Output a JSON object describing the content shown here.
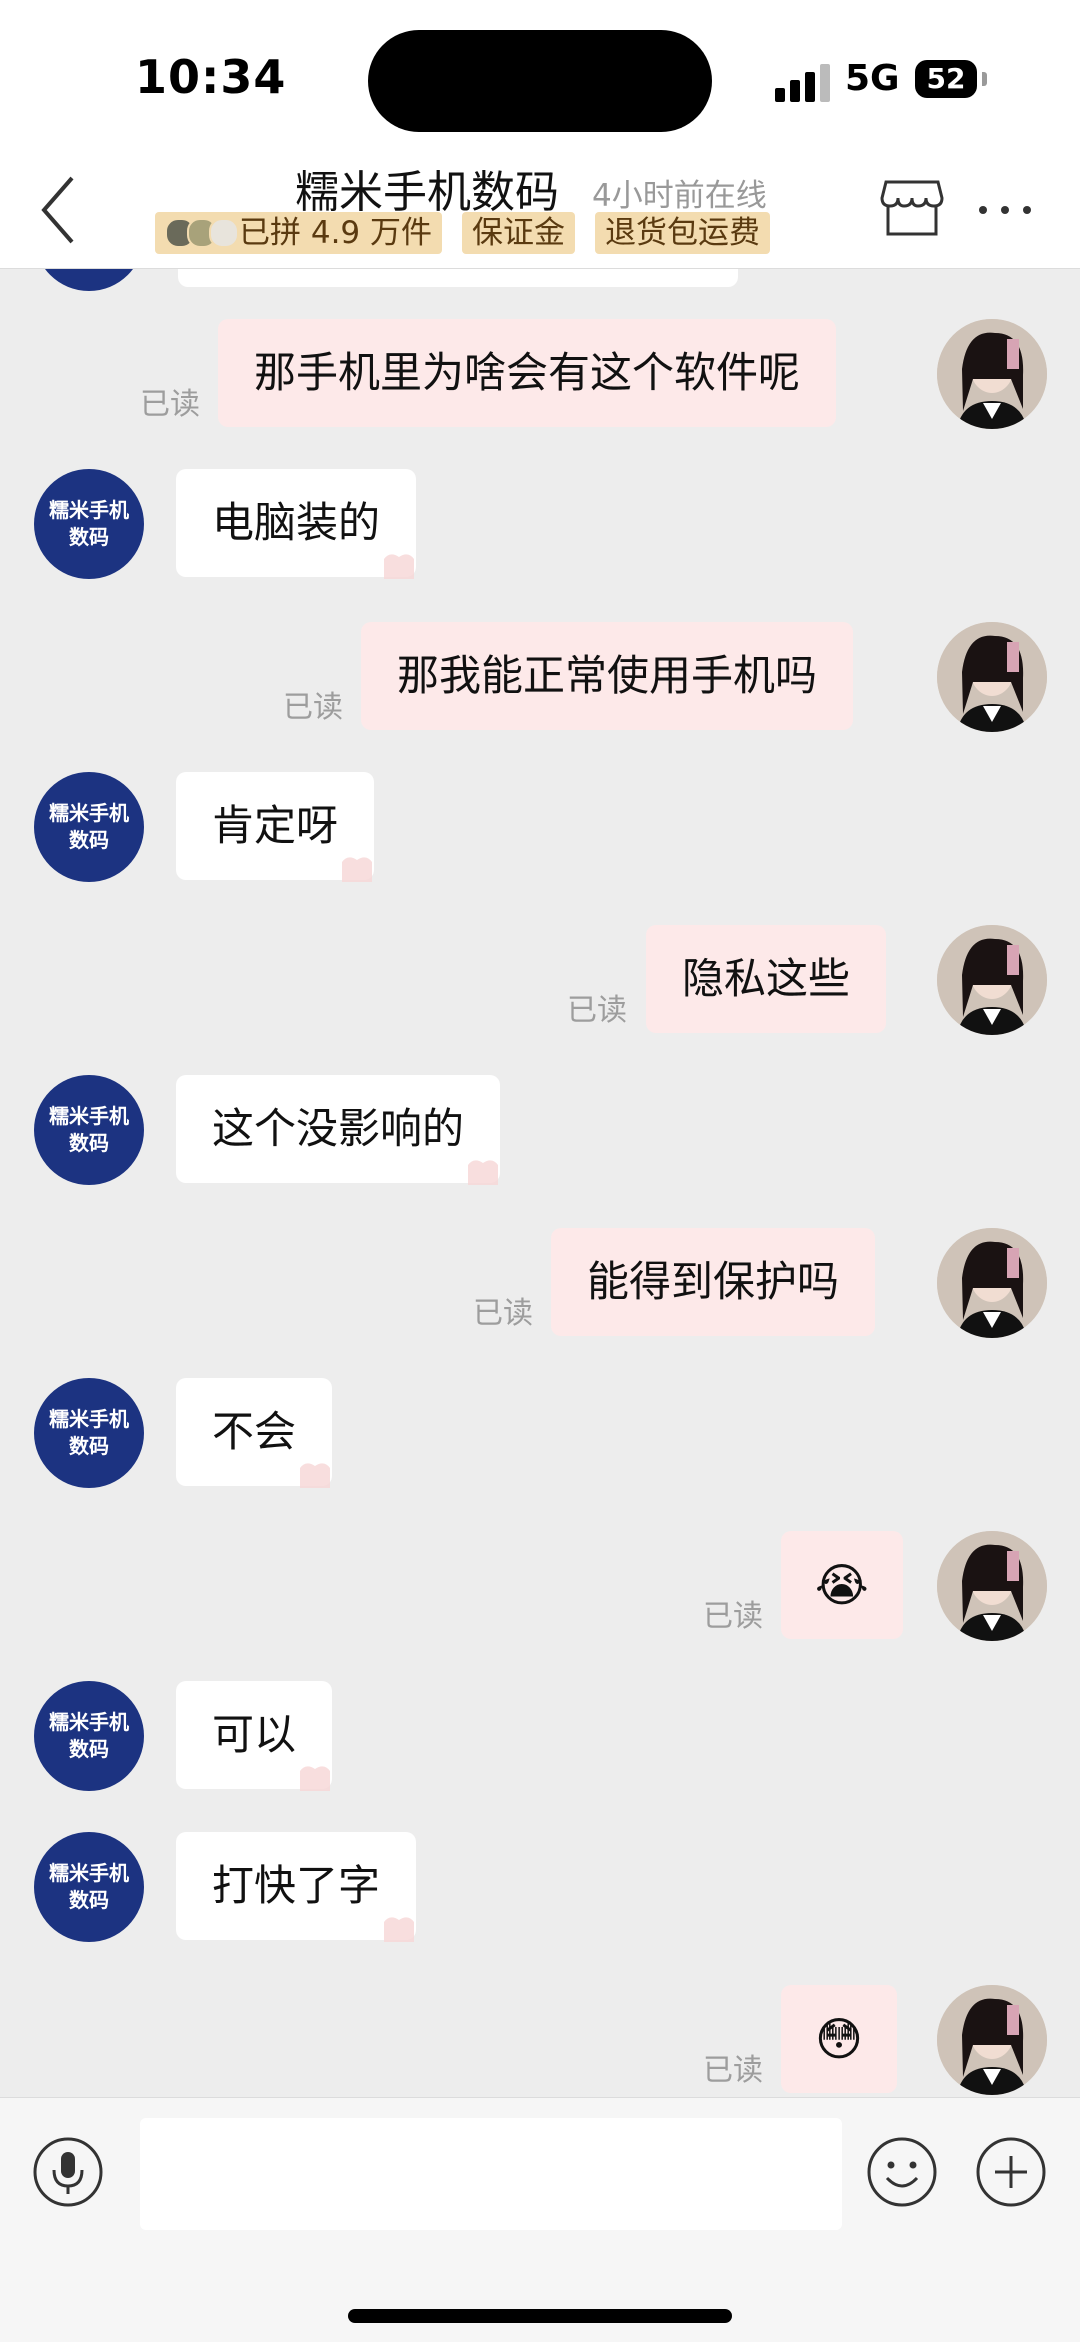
{
  "status_bar": {
    "time": "10:34",
    "network": "5G",
    "battery": "52"
  },
  "header": {
    "title": "糯米手机数码",
    "online_status": "4小时前在线",
    "badges": [
      "已拼 4.9 万件",
      "保证金",
      "退货包运费"
    ]
  },
  "shop_avatar_text": "糯米手机数码",
  "read_label": "已读",
  "messages": [
    {
      "side": "out",
      "text": "那手机里为啥会有这个软件呢"
    },
    {
      "side": "in",
      "text": "电脑装的"
    },
    {
      "side": "out",
      "text": "那我能正常使用手机吗"
    },
    {
      "side": "in",
      "text": "肯定呀"
    },
    {
      "side": "out",
      "text": "隐私这些"
    },
    {
      "side": "in",
      "text": "这个没影响的"
    },
    {
      "side": "out",
      "text": "能得到保护吗"
    },
    {
      "side": "in",
      "text": "不会"
    },
    {
      "side": "out",
      "text": "😭"
    },
    {
      "side": "in",
      "text": "可以"
    },
    {
      "side": "in",
      "text": "打快了字"
    },
    {
      "side": "out",
      "text": "😳"
    }
  ],
  "icons": {
    "back": "back-chevron-icon",
    "store": "store-icon",
    "more": "more-dots-icon",
    "mic": "microphone-icon",
    "emoji": "emoji-face-icon",
    "plus": "plus-icon",
    "pin": "pin-stamp-icon"
  },
  "colors": {
    "shop_avatar_bg": "#1c3381",
    "outgoing_bubble": "#fde9e9",
    "incoming_bubble": "#ffffff",
    "badge_bg": "#f3dcb0"
  }
}
